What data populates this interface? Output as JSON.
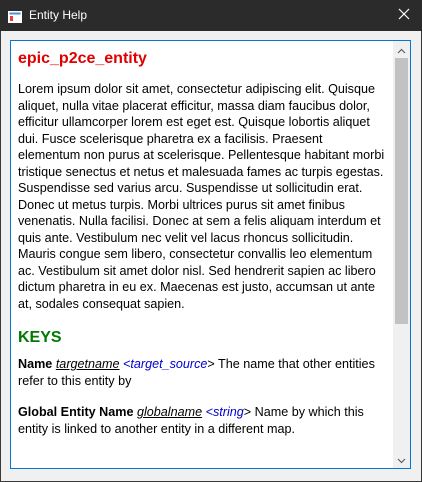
{
  "window": {
    "title": "Entity Help",
    "colors": {
      "titlebar": "#2b2b2b",
      "accent_border": "#0078d7",
      "entity_title": "#e00000",
      "keys_heading": "#007a00",
      "type_link": "#0000d0"
    }
  },
  "entity": {
    "name": "epic_p2ce_entity",
    "description": "Lorem ipsum dolor sit amet, consectetur adipiscing elit. Quisque aliquet, nulla vitae placerat efficitur, massa diam faucibus dolor, efficitur ullamcorper lorem est eget est. Quisque lobortis aliquet dui. Fusce scelerisque pharetra ex a facilisis. Praesent elementum non purus at scelerisque. Pellentesque habitant morbi tristique senectus et netus et malesuada fames ac turpis egestas. Suspendisse sed varius arcu. Suspendisse ut sollicitudin erat. Donec ut metus turpis. Morbi ultrices purus sit amet finibus venenatis. Nulla facilisi. Donec at sem a felis aliquam interdum et quis ante. Vestibulum nec velit vel lacus rhoncus sollicitudin. Mauris congue sem libero, consectetur convallis leo elementum ac. Vestibulum sit amet dolor nisl. Sed hendrerit sapien ac libero dictum pharetra in eu ex. Maecenas est justo, accumsan ut ante at, sodales consequat sapien."
  },
  "keys": {
    "heading": "KEYS",
    "items": [
      {
        "name": "Name",
        "field": "targetname",
        "type_open": "<",
        "type": "target_source",
        "type_close": ">",
        "description": "The name that other entities refer to this entity by"
      },
      {
        "name": "Global Entity Name",
        "field": "globalname",
        "type_open": "<",
        "type": "string",
        "type_close": ">",
        "description": "Name by which this entity is linked to another entity in a different map."
      }
    ]
  },
  "icons": {
    "app": "window-app-icon",
    "close": "close-icon",
    "scroll_up": "chevron-up-icon",
    "scroll_down": "chevron-down-icon"
  },
  "scroll": {
    "position_fraction": 0.0,
    "visible_fraction": 0.62
  }
}
